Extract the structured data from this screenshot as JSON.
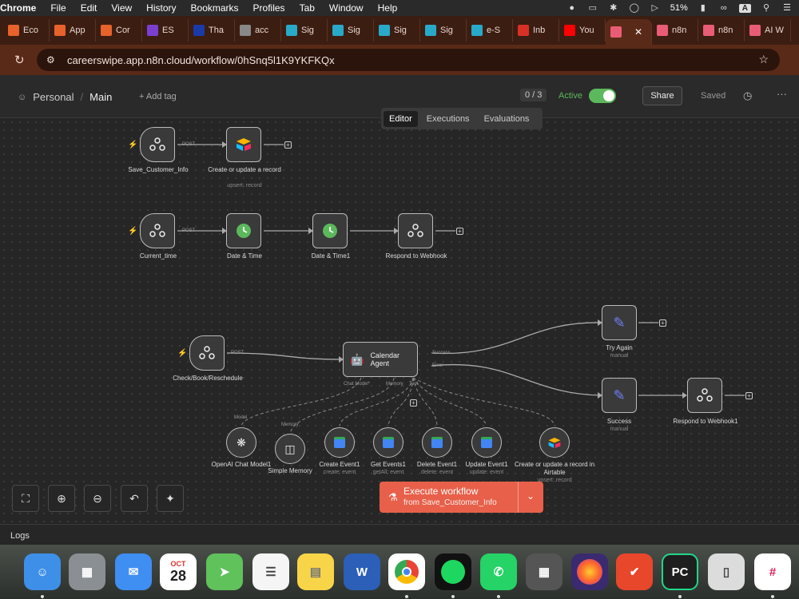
{
  "menubar": {
    "app": "Chrome",
    "items": [
      "File",
      "Edit",
      "View",
      "History",
      "Bookmarks",
      "Profiles",
      "Tab",
      "Window",
      "Help"
    ],
    "battery": "51%",
    "input": "A"
  },
  "tabs": [
    {
      "label": "Eco",
      "color": "#e8622c"
    },
    {
      "label": "App",
      "color": "#e8622c"
    },
    {
      "label": "Cor",
      "color": "#e8622c"
    },
    {
      "label": "ES",
      "color": "#7b3fd0"
    },
    {
      "label": "Tha",
      "color": "#1a3aa8"
    },
    {
      "label": "acc",
      "color": "#888888"
    },
    {
      "label": "Sig",
      "color": "#29a9c9"
    },
    {
      "label": "Sig",
      "color": "#29a9c9"
    },
    {
      "label": "Sig",
      "color": "#29a9c9"
    },
    {
      "label": "Sig",
      "color": "#29a9c9"
    },
    {
      "label": "e-S",
      "color": "#29a9c9"
    },
    {
      "label": "Inb",
      "color": "#d93025"
    },
    {
      "label": "You",
      "color": "#ff0000"
    },
    {
      "label": "",
      "color": "#e85d75",
      "active": true
    },
    {
      "label": "n8n",
      "color": "#e85d75"
    },
    {
      "label": "n8n",
      "color": "#e85d75"
    },
    {
      "label": "AI W",
      "color": "#e85d75"
    }
  ],
  "address": {
    "url": "careerswipe.app.n8n.cloud/workflow/0hSnq5l1K9YKFKQx"
  },
  "header": {
    "project": "Personal",
    "workflow": "Main",
    "add_tag": "+ Add tag",
    "counter": "0 / 3",
    "active_label": "Active",
    "active": true,
    "share": "Share",
    "saved": "Saved"
  },
  "view_tabs": [
    "Editor",
    "Executions",
    "Evaluations"
  ],
  "nodes": {
    "save_customer_info": {
      "label": "Save_Customer_Info",
      "method": "POST"
    },
    "airtable_create": {
      "label": "Create or update a record",
      "sub": "upsert: record"
    },
    "current_time": {
      "label": "Current_time",
      "method": "POST"
    },
    "date_time": {
      "label": "Date & Time"
    },
    "date_time1": {
      "label": "Date & Time1"
    },
    "respond_webhook": {
      "label": "Respond to Webhook"
    },
    "check_book": {
      "label": "Check/Book/Reschedule",
      "method": "POST"
    },
    "calendar_agent": {
      "label": "Calendar Agent",
      "ports": [
        "Chat Model*",
        "Memory",
        "Tool"
      ],
      "outputs": [
        "Success",
        "Error"
      ]
    },
    "try_again": {
      "label": "Try Again",
      "sub": "manual"
    },
    "success": {
      "label": "Success",
      "sub": "manual"
    },
    "respond_webhook1": {
      "label": "Respond to Webhook1"
    },
    "openai": {
      "label": "OpenAI Chat Model1",
      "port": "Model"
    },
    "memory": {
      "label": "Simple Memory",
      "port": "Memory"
    },
    "create_event": {
      "label": "Create Event1",
      "sub": "create: event"
    },
    "get_events": {
      "label": "Get Events1",
      "sub": "getAll: event"
    },
    "delete_event": {
      "label": "Delete Event1",
      "sub": "delete: event"
    },
    "update_event": {
      "label": "Update Event1",
      "sub": "update: event"
    },
    "airtable_agent": {
      "label": "Create or update a record in Airtable",
      "sub": "upsert: record"
    }
  },
  "execute": {
    "title": "Execute workflow",
    "from": "from Save_Customer_Info"
  },
  "logs": "Logs",
  "dock": {
    "calendar_month": "OCT",
    "calendar_day": "28",
    "pycharm": "PC"
  }
}
